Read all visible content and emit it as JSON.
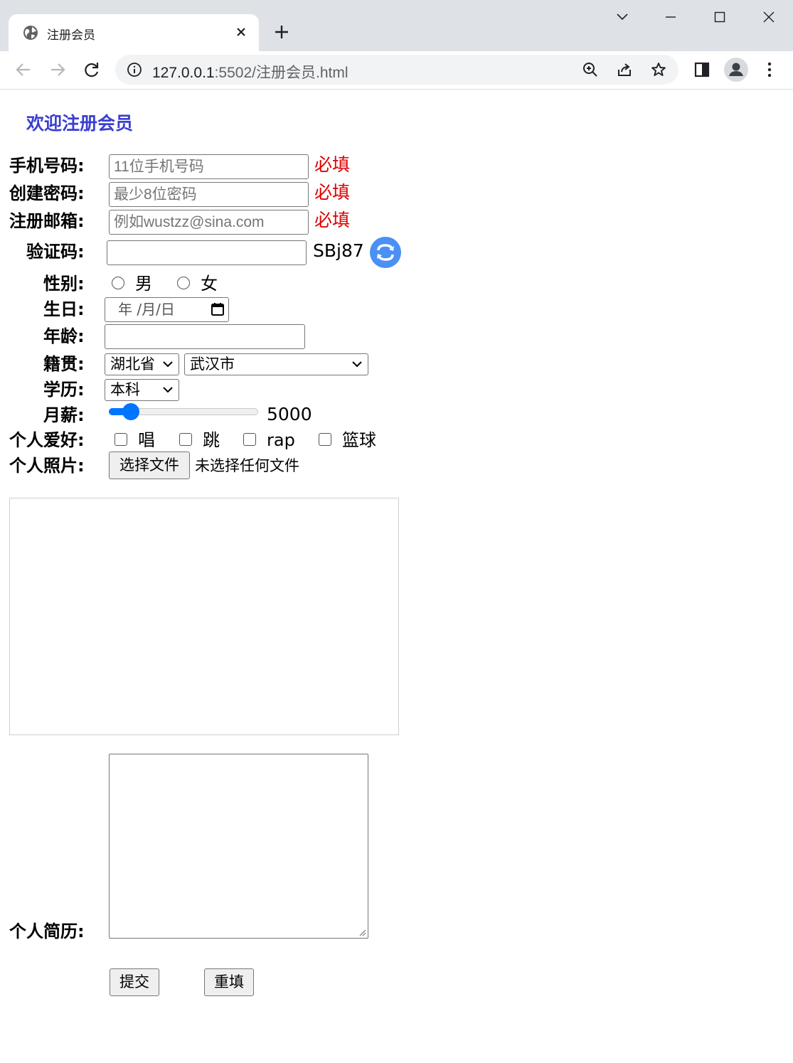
{
  "browser": {
    "tab_title": "注册会员",
    "url_host": "127.0.0.1",
    "url_rest": ":5502/注册会员.html"
  },
  "form": {
    "heading": "欢迎注册会员",
    "phone": {
      "label": "手机号码:",
      "placeholder": "11位手机号码",
      "required": "必填"
    },
    "password": {
      "label": "创建密码:",
      "placeholder": "最少8位密码",
      "required": "必填"
    },
    "email": {
      "label": "注册邮箱:",
      "placeholder": "例如wustzz@sina.com",
      "required": "必填"
    },
    "captcha": {
      "label": "验证码:",
      "code": "SBj87"
    },
    "gender": {
      "label": "性别:",
      "options": [
        "男",
        "女"
      ]
    },
    "birthday": {
      "label": "生日:",
      "placeholder": "年 /月/日"
    },
    "age": {
      "label": "年龄:"
    },
    "hometown": {
      "label": "籍贯:",
      "province": "湖北省",
      "city": "武汉市"
    },
    "education": {
      "label": "学历:",
      "value": "本科"
    },
    "salary": {
      "label": "月薪:",
      "value": 5000,
      "min": 0,
      "max": 50000
    },
    "hobbies": {
      "label": "个人爱好:",
      "options": [
        "唱",
        "跳",
        "rap",
        "篮球"
      ]
    },
    "photo": {
      "label": "个人照片:",
      "button": "选择文件",
      "status": "未选择任何文件"
    },
    "resume": {
      "label": "个人简历:"
    },
    "submit": "提交",
    "reset": "重填"
  },
  "colors": {
    "heading": "#3a3fd0",
    "required": "#e00000",
    "accent": "#0075ff",
    "refresh": "#4a90f5"
  }
}
